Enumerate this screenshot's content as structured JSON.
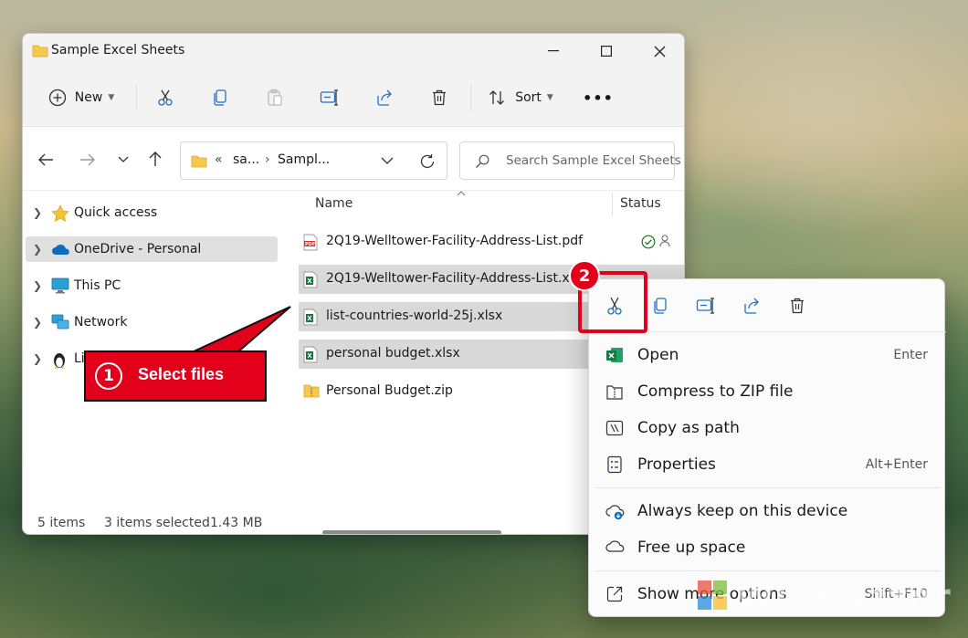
{
  "window": {
    "title": "Sample Excel Sheets"
  },
  "toolbar": {
    "new_label": "New",
    "sort_label": "Sort",
    "more_label": "•••"
  },
  "navbar": {
    "address": {
      "prefix": "«",
      "seg1": "sa...",
      "seg2": "Sampl..."
    },
    "search_placeholder": "Search Sample Excel Sheets"
  },
  "sidebar": {
    "items": [
      {
        "label": "Quick access"
      },
      {
        "label": "OneDrive - Personal"
      },
      {
        "label": "This PC"
      },
      {
        "label": "Network"
      },
      {
        "label": "Li"
      }
    ]
  },
  "content": {
    "col_name": "Name",
    "col_status": "Status",
    "files": [
      {
        "name": "2Q19-Welltower-Facility-Address-List.pdf",
        "type": "pdf",
        "selected": false
      },
      {
        "name": "2Q19-Welltower-Facility-Address-List.xlsx",
        "type": "xlsx",
        "selected": true
      },
      {
        "name": "list-countries-world-25j.xlsx",
        "type": "xlsx",
        "selected": true
      },
      {
        "name": "personal budget.xlsx",
        "type": "xlsx",
        "selected": true
      },
      {
        "name": "Personal Budget.zip",
        "type": "zip",
        "selected": false
      }
    ]
  },
  "status": {
    "items_count": "5 items",
    "selected": "3 items selected",
    "size": "1.43 MB"
  },
  "context_menu": {
    "items": [
      {
        "label": "Open",
        "shortcut": "Enter"
      },
      {
        "label": "Compress to ZIP file",
        "shortcut": ""
      },
      {
        "label": "Copy as path",
        "shortcut": ""
      },
      {
        "label": "Properties",
        "shortcut": "Alt+Enter"
      },
      {
        "label": "Always keep on this device",
        "shortcut": ""
      },
      {
        "label": "Free up space",
        "shortcut": ""
      },
      {
        "label": "Show more options",
        "shortcut": "Shift+F10"
      }
    ]
  },
  "annotations": {
    "step1_number": "1",
    "step1_text": "Select files",
    "step2_number": "2"
  },
  "watermark": "WinBuzzer",
  "colors": {
    "accent_red": "#e3001b",
    "excel_green": "#1d6f42",
    "onedrive_blue": "#0f6cbd",
    "folder_yellow": "#f8c84a"
  }
}
